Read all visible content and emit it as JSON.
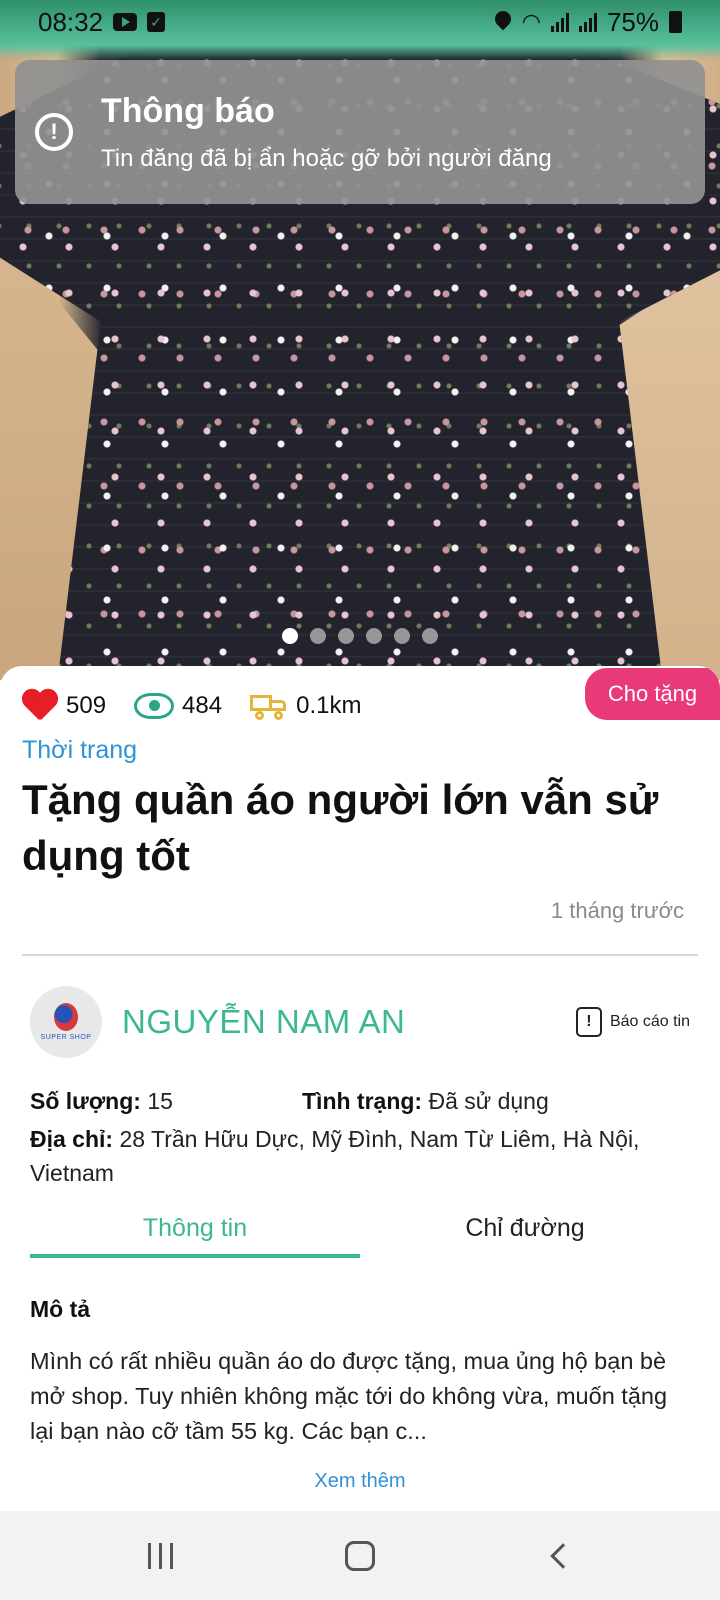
{
  "status_bar": {
    "time": "08:32",
    "battery": "75%",
    "icons": [
      "youtube-icon",
      "check-icon",
      "location-icon",
      "wifi-icon",
      "signal-icon",
      "signal-icon",
      "battery-icon"
    ]
  },
  "toast": {
    "title": "Thông báo",
    "message": "Tin đăng đã bị ẩn hoặc gỡ bởi người đăng",
    "icon": "alert-icon"
  },
  "gallery": {
    "image_count": 6,
    "active_index": 0
  },
  "post": {
    "badge": "Cho tặng",
    "likes": "509",
    "views": "484",
    "distance": "0.1km",
    "category": "Thời trang",
    "title": "Tặng quần áo người lớn vẫn sử dụng tốt",
    "posted_time": "1 tháng trước"
  },
  "seller": {
    "name": "NGUYỄN NAM AN",
    "avatar_text": "SUPER SHOP",
    "report_label": "Báo cáo tin"
  },
  "details": {
    "quantity_label": "Số lượng:",
    "quantity_value": "15",
    "condition_label": "Tình trạng:",
    "condition_value": "Đã sử dụng",
    "address_label": "Địa chỉ:",
    "address_value": "28 Trần Hữu Dực, Mỹ Đình, Nam Từ Liêm, Hà Nội, Vietnam"
  },
  "tabs": [
    {
      "label": "Thông tin",
      "active": true
    },
    {
      "label": "Chỉ đường",
      "active": false
    }
  ],
  "description": {
    "title": "Mô tả",
    "text": "Mình có rất nhiều quần áo do được tặng, mua ủng hộ bạn bè mở shop. Tuy nhiên không mặc tới do không vừa, muốn tặng lại bạn nào cỡ tầm 55 kg. Các bạn c...",
    "see_more": "Xem thêm"
  },
  "colors": {
    "accent_green": "#3cb98a",
    "badge_pink": "#e83a79",
    "link_blue": "#2f93d6",
    "heart_red": "#e61e26",
    "truck_yellow": "#e5b43a"
  }
}
